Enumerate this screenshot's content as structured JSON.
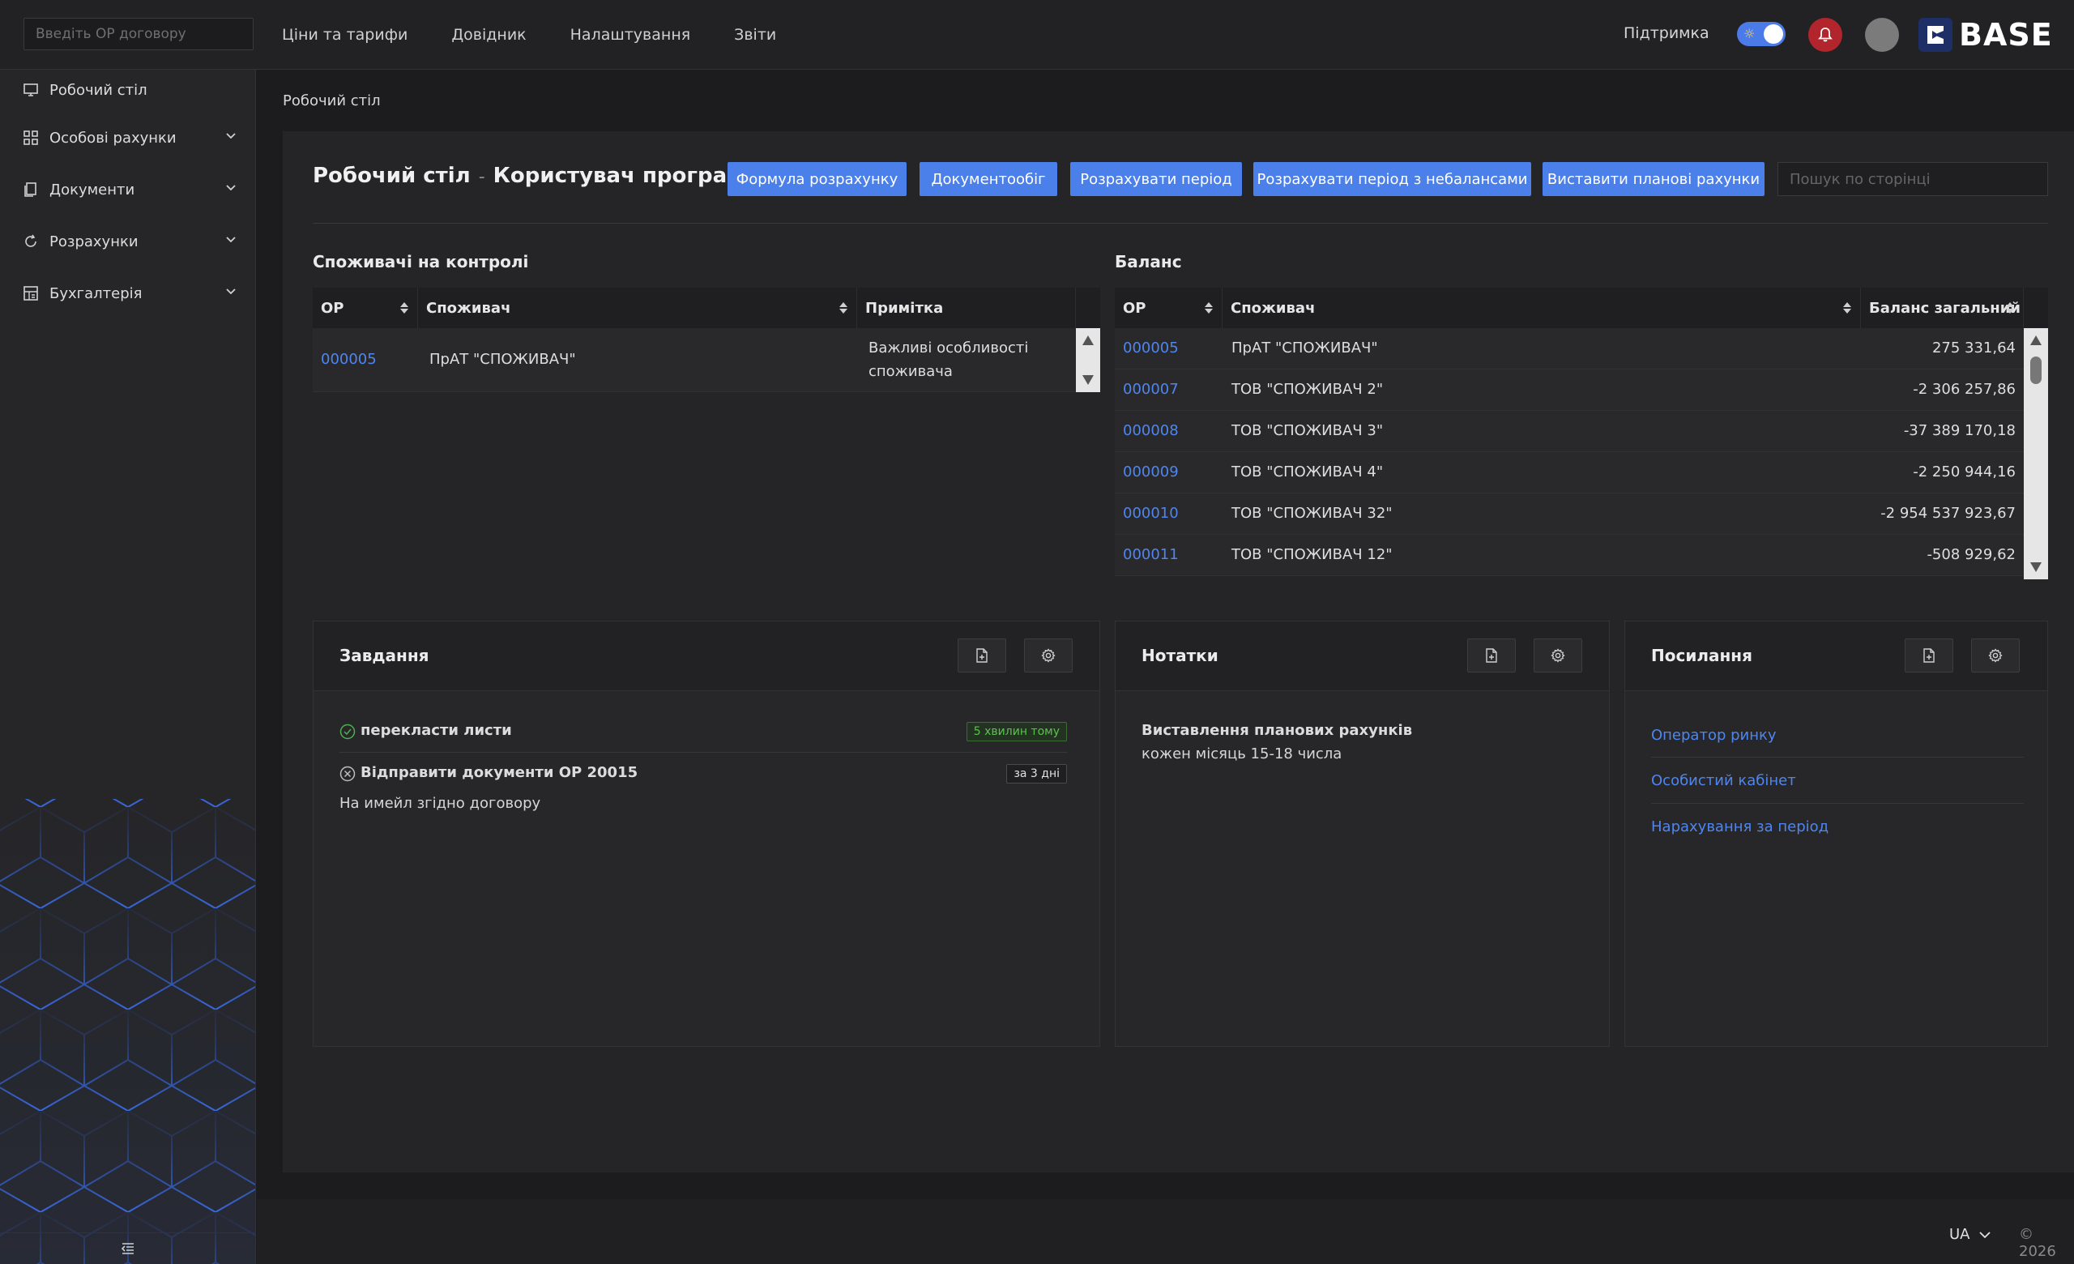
{
  "topbar": {
    "search_placeholder": "Введіть ОР договору",
    "nav": [
      "Ціни та тарифи",
      "Довідник",
      "Налаштування",
      "Звіти"
    ],
    "support": "Підтримка",
    "logo_text": "BASE"
  },
  "sidebar": {
    "items": [
      {
        "label": "Робочий стіл",
        "icon": "monitor-icon"
      },
      {
        "label": "Особові рахунки",
        "icon": "grid-icon"
      },
      {
        "label": "Документи",
        "icon": "documents-icon"
      },
      {
        "label": "Розрахунки",
        "icon": "refresh-icon"
      },
      {
        "label": "Бухгалтерія",
        "icon": "ledger-icon"
      }
    ]
  },
  "breadcrumb": "Робочий стіл",
  "page": {
    "title": "Робочий стіл",
    "separator": "-",
    "subtitle": "Користувач програми",
    "buttons": [
      "Формула розрахунку",
      "Документообіг",
      "Розрахувати період",
      "Розрахувати період з небалансами",
      "Виставити планові рахунки"
    ],
    "search_placeholder": "Пошук по сторінці"
  },
  "control": {
    "title": "Споживачі на контролі",
    "columns": [
      "ОР",
      "Споживач",
      "Примітка"
    ],
    "rows": [
      {
        "op": "000005",
        "consumer": "ПрАТ \"СПОЖИВАЧ\"",
        "note_line1": "Важливі особливості",
        "note_line2": "споживача"
      }
    ]
  },
  "balance": {
    "title": "Баланс",
    "columns": [
      "ОР",
      "Споживач",
      "Баланс загальний"
    ],
    "rows": [
      {
        "op": "000005",
        "consumer": "ПрАТ \"СПОЖИВАЧ\"",
        "balance": "275 331,64"
      },
      {
        "op": "000007",
        "consumer": "ТОВ \"СПОЖИВАЧ 2\"",
        "balance": "-2 306 257,86"
      },
      {
        "op": "000008",
        "consumer": "ТОВ \"СПОЖИВАЧ 3\"",
        "balance": "-37 389 170,18"
      },
      {
        "op": "000009",
        "consumer": "ТОВ \"СПОЖИВАЧ 4\"",
        "balance": "-2 250 944,16"
      },
      {
        "op": "000010",
        "consumer": "ТОВ \"СПОЖИВАЧ 32\"",
        "balance": "-2 954 537 923,67"
      },
      {
        "op": "000011",
        "consumer": "ТОВ \"СПОЖИВАЧ 12\"",
        "balance": "-508 929,62"
      }
    ]
  },
  "tasks": {
    "title": "Завдання",
    "items": [
      {
        "text": "перекласти листи",
        "badge": "5 хвилин тому",
        "status": "done"
      },
      {
        "text": "Відправити документи ОР 20015",
        "badge": "за 3 дні",
        "status": "cancelled",
        "description": "На имейл згідно договору"
      }
    ]
  },
  "notes": {
    "title": "Нотатки",
    "line1": "Виставлення планових рахунків",
    "line2": "кожен місяць 15-18 числа"
  },
  "links": {
    "title": "Посилання",
    "items": [
      "Оператор ринку",
      "Особистий кабінет",
      "Нарахування за період"
    ]
  },
  "footer": {
    "lang": "UA",
    "copyright": "© 2026"
  },
  "colors": {
    "accent": "#4b7fea",
    "link": "#4f86ee",
    "danger": "#b3252d",
    "success": "#4caf50"
  }
}
